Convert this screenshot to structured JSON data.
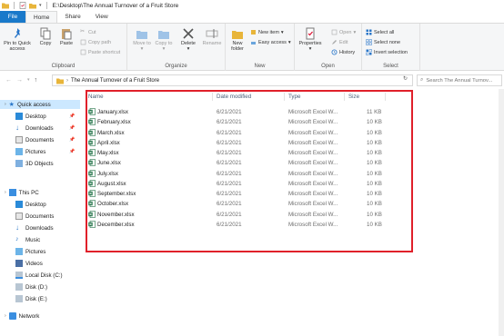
{
  "window": {
    "title": "E:\\Desktop\\The Annual Turnover of a Fruit Store"
  },
  "tabs": [
    "File",
    "Home",
    "Share",
    "View"
  ],
  "ribbon": {
    "clipboard": {
      "pin": "Pin to Quick access",
      "copy": "Copy",
      "paste": "Paste",
      "cut": "Cut",
      "copy_path": "Copy path",
      "paste_shortcut": "Paste shortcut",
      "label": "Clipboard"
    },
    "organize": {
      "move_to": "Move to",
      "copy_to": "Copy to",
      "delete": "Delete",
      "rename": "Rename",
      "label": "Organize"
    },
    "new": {
      "new_folder": "New folder",
      "new_item": "New item",
      "easy_access": "Easy access",
      "label": "New"
    },
    "open": {
      "properties": "Properties",
      "open": "Open",
      "edit": "Edit",
      "history": "History",
      "label": "Open"
    },
    "select": {
      "select_all": "Select all",
      "select_none": "Select none",
      "invert": "Invert selection",
      "label": "Select"
    }
  },
  "address": {
    "path": "The Annual Turnover of a Fruit Store",
    "search_placeholder": "Search The Annual Turnov..."
  },
  "nav": {
    "quick_access": "Quick access",
    "quick_items": [
      "Desktop",
      "Downloads",
      "Documents",
      "Pictures",
      "3D Objects"
    ],
    "this_pc": "This PC",
    "pc_items": [
      "Desktop",
      "Documents",
      "Downloads",
      "Music",
      "Pictures",
      "Videos",
      "Local Disk (C:)",
      "Disk (D:)",
      "Disk (E:)"
    ],
    "network": "Network"
  },
  "columns": {
    "name": "Name",
    "date": "Date modified",
    "type": "Type",
    "size": "Size"
  },
  "files": [
    {
      "name": "January.xlsx",
      "date": "6/21/2021",
      "type": "Microsoft Excel W...",
      "size": "11 KB"
    },
    {
      "name": "February.xlsx",
      "date": "6/21/2021",
      "type": "Microsoft Excel W...",
      "size": "10 KB"
    },
    {
      "name": "March.xlsx",
      "date": "6/21/2021",
      "type": "Microsoft Excel W...",
      "size": "10 KB"
    },
    {
      "name": "April.xlsx",
      "date": "6/21/2021",
      "type": "Microsoft Excel W...",
      "size": "10 KB"
    },
    {
      "name": "May.xlsx",
      "date": "6/21/2021",
      "type": "Microsoft Excel W...",
      "size": "10 KB"
    },
    {
      "name": "June.xlsx",
      "date": "6/21/2021",
      "type": "Microsoft Excel W...",
      "size": "10 KB"
    },
    {
      "name": "July.xlsx",
      "date": "6/21/2021",
      "type": "Microsoft Excel W...",
      "size": "10 KB"
    },
    {
      "name": "August.xlsx",
      "date": "6/21/2021",
      "type": "Microsoft Excel W...",
      "size": "10 KB"
    },
    {
      "name": "September.xlsx",
      "date": "6/21/2021",
      "type": "Microsoft Excel W...",
      "size": "10 KB"
    },
    {
      "name": "October.xlsx",
      "date": "6/21/2021",
      "type": "Microsoft Excel W...",
      "size": "10 KB"
    },
    {
      "name": "November.xlsx",
      "date": "6/21/2021",
      "type": "Microsoft Excel W...",
      "size": "10 KB"
    },
    {
      "name": "December.xlsx",
      "date": "6/21/2021",
      "type": "Microsoft Excel W...",
      "size": "10 KB"
    }
  ],
  "colors": {
    "accent": "#1979ca",
    "selection": "#cce8ff",
    "excel": "#1e7145",
    "highlight": "#e0202a"
  }
}
